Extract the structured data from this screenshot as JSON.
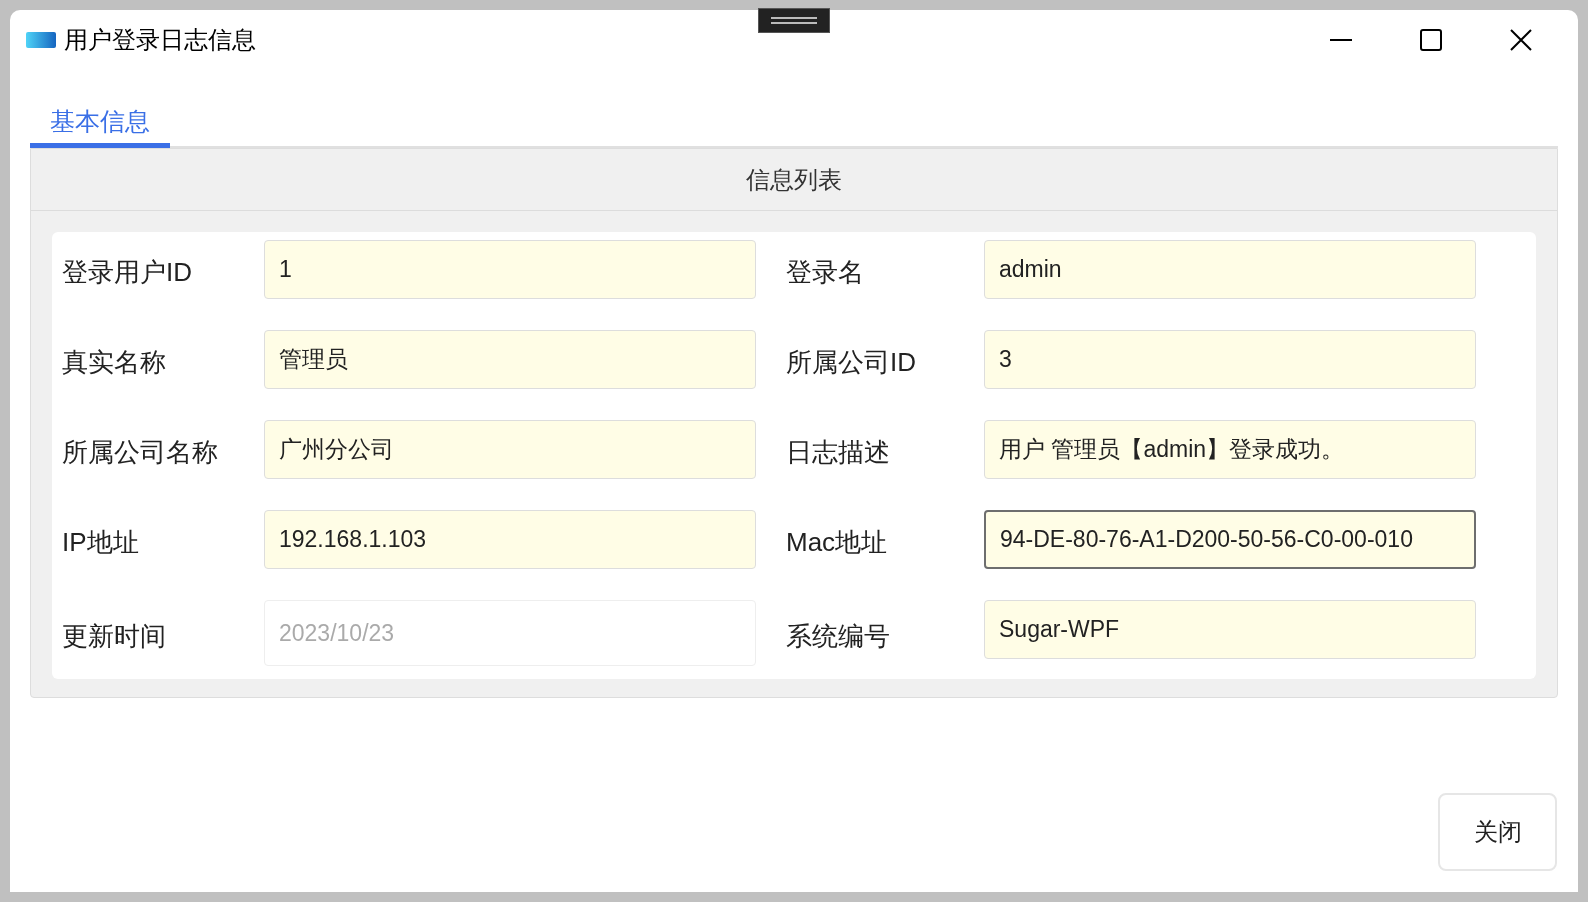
{
  "window": {
    "title": "用户登录日志信息"
  },
  "tabs": [
    {
      "label": "基本信息",
      "selected": true
    }
  ],
  "panel": {
    "header": "信息列表"
  },
  "fields": [
    {
      "label": "登录用户ID",
      "value": "1",
      "disabled": false,
      "focused": false
    },
    {
      "label": "登录名",
      "value": "admin",
      "disabled": false,
      "focused": false
    },
    {
      "label": "真实名称",
      "value": "管理员",
      "disabled": false,
      "focused": false
    },
    {
      "label": "所属公司ID",
      "value": "3",
      "disabled": false,
      "focused": false
    },
    {
      "label": "所属公司名称",
      "value": "广州分公司",
      "disabled": false,
      "focused": false
    },
    {
      "label": "日志描述",
      "value": "用户 管理员【admin】登录成功。",
      "disabled": false,
      "focused": false
    },
    {
      "label": "IP地址",
      "value": "192.168.1.103",
      "disabled": false,
      "focused": false
    },
    {
      "label": "Mac地址",
      "value": "94-DE-80-76-A1-D200-50-56-C0-00-010",
      "disabled": false,
      "focused": true
    },
    {
      "label": "更新时间",
      "value": "2023/10/23",
      "disabled": true,
      "focused": false
    },
    {
      "label": "系统编号",
      "value": "Sugar-WPF",
      "disabled": false,
      "focused": false
    }
  ],
  "buttons": [
    "关闭"
  ]
}
